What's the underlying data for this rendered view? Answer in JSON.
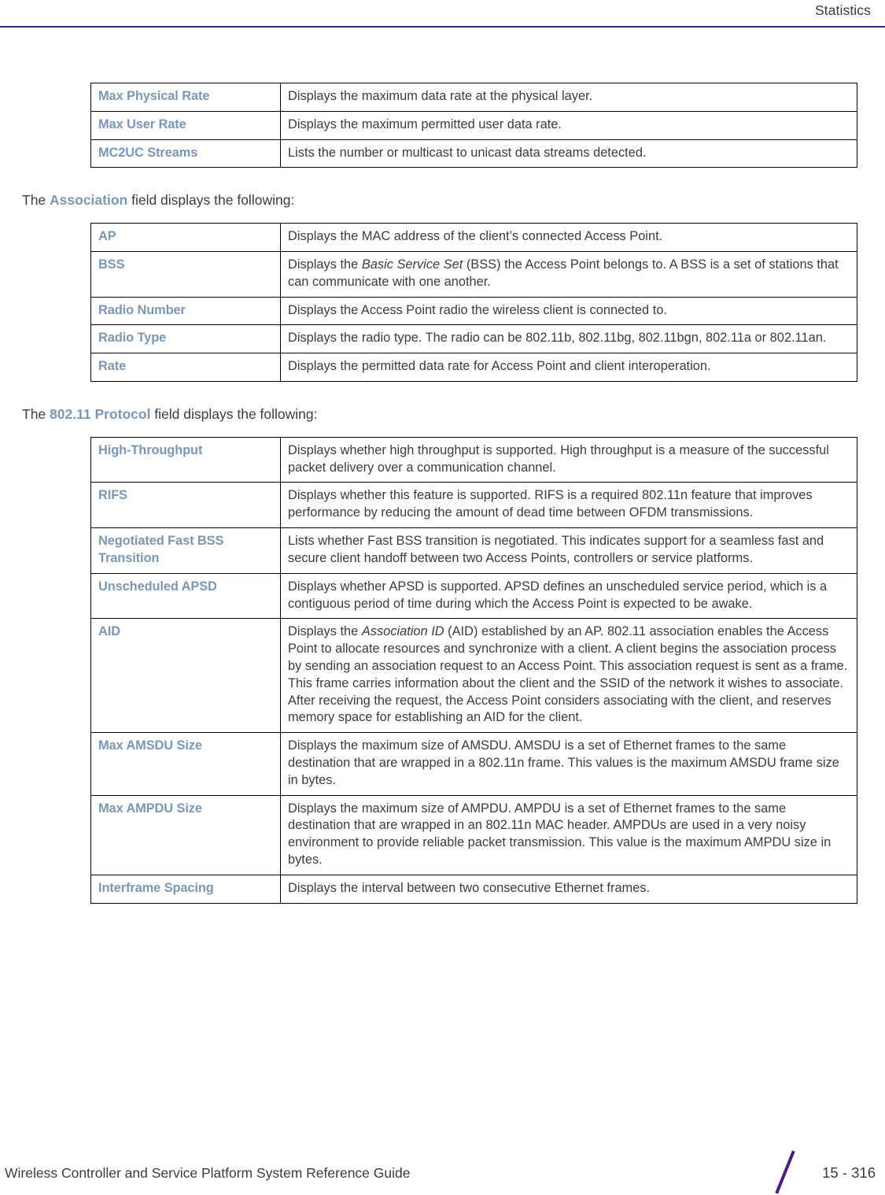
{
  "header": {
    "title": "Statistics",
    "rule_color": "#4b1f80"
  },
  "colors": {
    "label_blue": "#7d96b2",
    "body_text": "#3c3c3c",
    "accent_purple": "#4b1f80",
    "table_border": "#000000"
  },
  "tables": [
    {
      "id": "rate-table",
      "rows": [
        {
          "label": "Max Physical Rate",
          "desc_parts": [
            {
              "text": "Displays the maximum data rate at the physical layer.",
              "style": "normal"
            }
          ]
        },
        {
          "label": "Max User Rate",
          "desc_parts": [
            {
              "text": "Displays the maximum permitted user data rate.",
              "style": "normal"
            }
          ]
        },
        {
          "label": "MC2UC Streams",
          "desc_parts": [
            {
              "text": "Lists the number or multicast to unicast data streams detected.",
              "style": "normal"
            }
          ]
        }
      ]
    },
    {
      "id": "association-table",
      "rows": [
        {
          "label": "AP",
          "desc_parts": [
            {
              "text": "Displays the MAC address of the client’s connected Access Point.",
              "style": "normal"
            }
          ]
        },
        {
          "label": "BSS",
          "desc_parts": [
            {
              "text": "Displays the ",
              "style": "normal"
            },
            {
              "text": "Basic Service Set",
              "style": "italic"
            },
            {
              "text": " (BSS) the Access Point belongs to. A BSS is a set of stations that can communicate with one another.",
              "style": "normal"
            }
          ]
        },
        {
          "label": "Radio Number",
          "desc_parts": [
            {
              "text": "Displays the Access Point radio the wireless client is connected to.",
              "style": "normal"
            }
          ]
        },
        {
          "label": "Radio Type",
          "desc_parts": [
            {
              "text": "Displays the radio type. The radio can be 802.11b, 802.11bg, 802.11bgn, 802.11a or 802.11an.",
              "style": "normal"
            }
          ]
        },
        {
          "label": "Rate",
          "desc_parts": [
            {
              "text": "Displays the permitted data rate for Access Point and client interoperation.",
              "style": "normal"
            }
          ]
        }
      ]
    },
    {
      "id": "protocol-table",
      "rows": [
        {
          "label": "High-Throughput",
          "desc_parts": [
            {
              "text": "Displays whether high throughput is supported. High throughput is a measure of the successful packet delivery over a communication channel.",
              "style": "normal"
            }
          ]
        },
        {
          "label": "RIFS",
          "desc_parts": [
            {
              "text": "Displays whether this feature is supported. RIFS is a required 802.11n feature that improves performance by reducing the amount of dead time between OFDM transmissions.",
              "style": "normal"
            }
          ]
        },
        {
          "label": "Negotiated Fast BSS Transition",
          "desc_parts": [
            {
              "text": "Lists whether Fast BSS transition is negotiated. This indicates support for a seamless fast and secure client handoff between two Access Points, controllers or service platforms.",
              "style": "normal"
            }
          ]
        },
        {
          "label": "Unscheduled APSD",
          "desc_parts": [
            {
              "text": "Displays whether APSD is supported. APSD defines an unscheduled service period, which is a contiguous period of time during which the Access Point is expected to be awake.",
              "style": "normal"
            }
          ]
        },
        {
          "label": "AID",
          "desc_parts": [
            {
              "text": "Displays the ",
              "style": "normal"
            },
            {
              "text": "Association ID",
              "style": "italic"
            },
            {
              "text": " (AID) established by an AP. 802.11 association enables the Access Point to allocate resources and synchronize with a client. A client begins the association process by sending an association request to an Access Point. This association request is sent as a frame. This frame carries information about the client and the SSID of the network it wishes to associate. After receiving the request, the Access Point considers associating with the client, and reserves memory space for establishing an AID for the client.",
              "style": "normal"
            }
          ]
        },
        {
          "label": "Max AMSDU Size",
          "desc_parts": [
            {
              "text": "Displays the maximum size of AMSDU. AMSDU is a set of Ethernet frames to the same destination that are wrapped in a 802.11n frame. This values is the maximum AMSDU frame size in bytes.",
              "style": "normal"
            }
          ]
        },
        {
          "label": "Max AMPDU Size",
          "desc_parts": [
            {
              "text": "Displays the maximum size of AMPDU. AMPDU is a set of Ethernet frames to the same destination that are wrapped in an 802.11n MAC header. AMPDUs are used in a very noisy environment to provide reliable packet transmission. This value is the maximum AMPDU size in bytes.",
              "style": "normal"
            }
          ]
        },
        {
          "label": "Interframe Spacing",
          "desc_parts": [
            {
              "text": "Displays the interval between two consecutive Ethernet frames.",
              "style": "normal"
            }
          ]
        }
      ]
    }
  ],
  "paragraphs": [
    {
      "id": "association-lead",
      "prefix": "The ",
      "field": "Association",
      "suffix": " field displays the following:"
    },
    {
      "id": "protocol-lead",
      "prefix": "The ",
      "field": "802.11 Protocol",
      "suffix": " field displays the following:"
    }
  ],
  "footer": {
    "guide_title": "Wireless Controller and Service Platform System Reference Guide",
    "page_number": "15 - 316"
  }
}
